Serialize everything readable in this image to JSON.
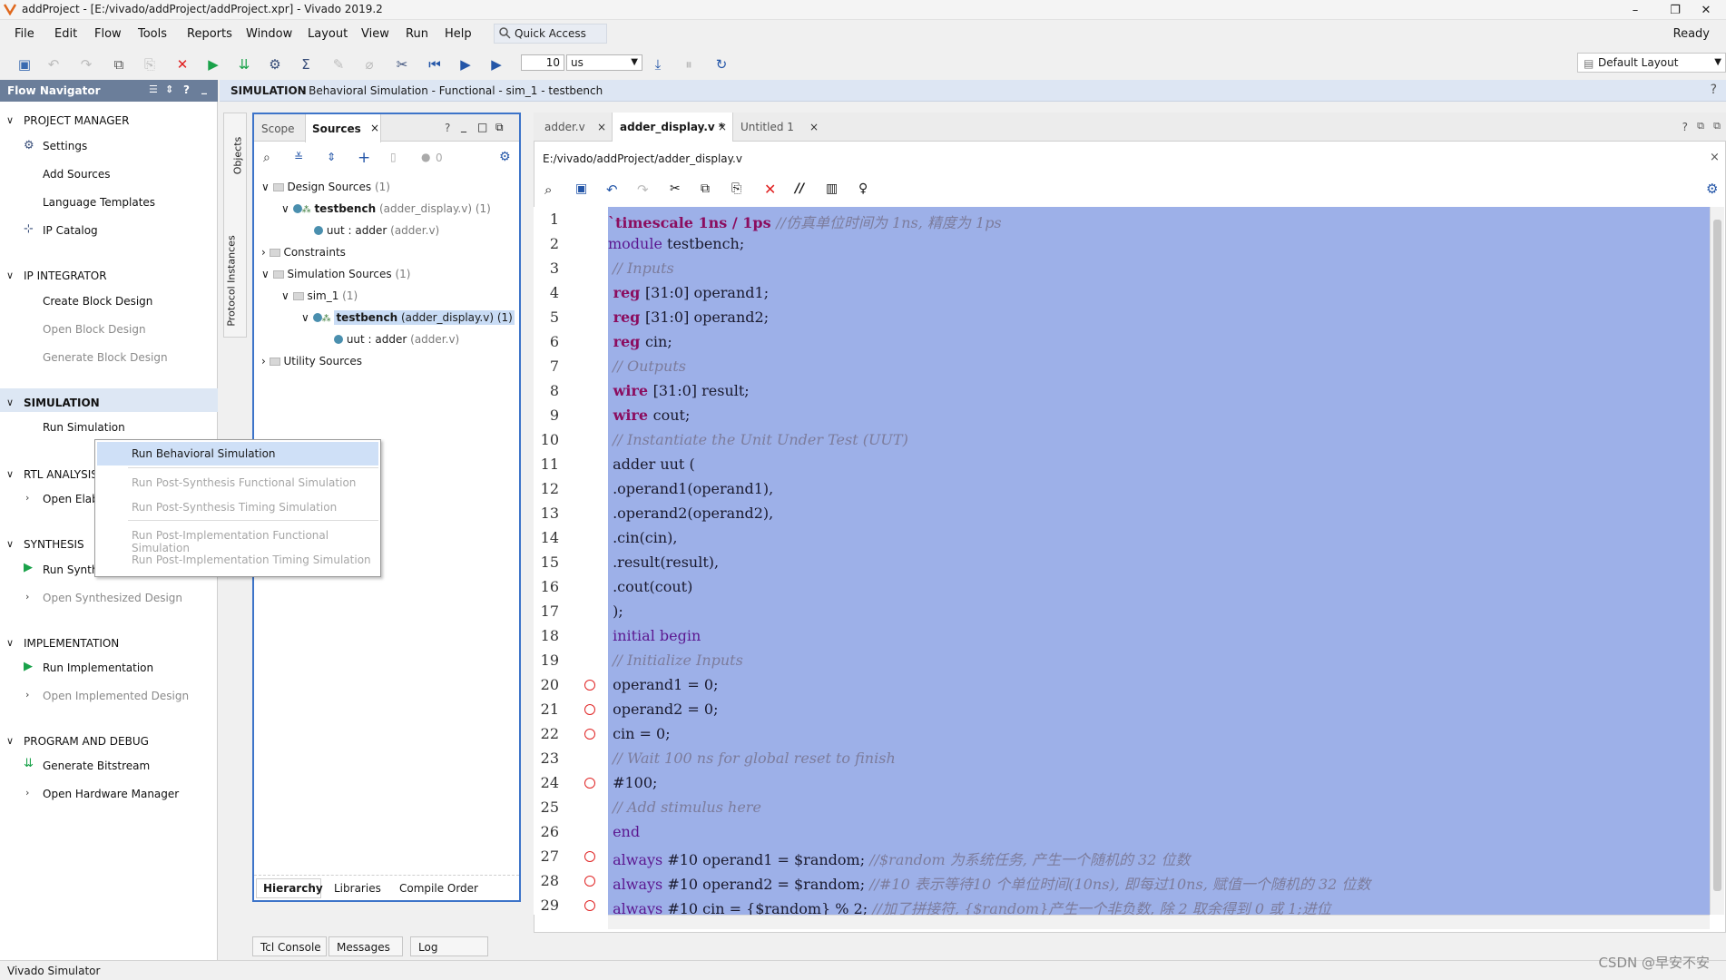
{
  "window": {
    "title": "addProject - [E:/vivado/addProject/addProject.xpr] - Vivado 2019.2",
    "status": "Ready",
    "quick_access": "Quick Access"
  },
  "menu": [
    "File",
    "Edit",
    "Flow",
    "Tools",
    "Reports",
    "Window",
    "Layout",
    "View",
    "Run",
    "Help"
  ],
  "toolbar": {
    "run_time": "10",
    "time_unit": "us",
    "layout": "Default Layout"
  },
  "flow_navigator": {
    "title": "Flow Navigator",
    "sections": {
      "project_manager": {
        "label": "PROJECT MANAGER",
        "items": [
          "Settings",
          "Add Sources",
          "Language Templates",
          "IP Catalog"
        ]
      },
      "ip_integrator": {
        "label": "IP INTEGRATOR",
        "items": [
          "Create Block Design",
          "Open Block Design",
          "Generate Block Design"
        ]
      },
      "simulation": {
        "label": "SIMULATION",
        "items": [
          "Run Simulation"
        ]
      },
      "rtl_analysis": {
        "label": "RTL ANALYSIS",
        "items": [
          "Open Elab"
        ]
      },
      "synthesis": {
        "label": "SYNTHESIS",
        "items": [
          "Run Synth",
          "Open Synthesized Design"
        ]
      },
      "implementation": {
        "label": "IMPLEMENTATION",
        "items": [
          "Run Implementation",
          "Open Implemented Design"
        ]
      },
      "program_debug": {
        "label": "PROGRAM AND DEBUG",
        "items": [
          "Generate Bitstream",
          "Open Hardware Manager"
        ]
      }
    }
  },
  "context_menu": {
    "items": [
      "Run Behavioral Simulation",
      "Run Post-Synthesis Functional Simulation",
      "Run Post-Synthesis Timing Simulation",
      "Run Post-Implementation Functional Simulation",
      "Run Post-Implementation Timing Simulation"
    ]
  },
  "sim_header": {
    "prefix": "SIMULATION",
    "detail": " - Behavioral Simulation - Functional - sim_1 - testbench"
  },
  "side_tabs": [
    "Objects",
    "Protocol Instances"
  ],
  "sources": {
    "tabs": [
      "Scope",
      "Sources"
    ],
    "badge": "0",
    "tree": {
      "design_sources": "Design Sources",
      "design_sources_count": " (1)",
      "testbench": "testbench",
      "testbench_file": " (adder_display.v) (1)",
      "uut": "uut : adder",
      "uut_file": " (adder.v)",
      "constraints": "Constraints",
      "sim_sources": "Simulation Sources",
      "sim_sources_count": " (1)",
      "sim_1": "sim_1",
      "sim_1_count": " (1)",
      "testbench2": "testbench",
      "testbench2_file": " (adder_display.v) (1)",
      "uut2": "uut : adder",
      "uut2_file": " (adder.v)",
      "utility": "Utility Sources"
    },
    "bottom_tabs": [
      "Hierarchy",
      "Libraries",
      "Compile Order"
    ]
  },
  "editor": {
    "tabs": [
      "adder.v",
      "adder_display.v *",
      "Untitled 1"
    ],
    "file_path": "E:/vivado/addProject/adder_display.v",
    "lines": [
      [
        {
          "t": "`timescale 1ns / 1ps ",
          "c": "kw"
        },
        {
          "t": "//仿真单位时间为 1ns, 精度为 1ps",
          "c": "cm"
        }
      ],
      [
        {
          "t": "module ",
          "c": "kw2"
        },
        {
          "t": "testbench;",
          "c": ""
        }
      ],
      [
        {
          "t": " // Inputs",
          "c": "cm"
        }
      ],
      [
        {
          "t": " reg ",
          "c": "kw"
        },
        {
          "t": "[31:0] operand1;",
          "c": ""
        }
      ],
      [
        {
          "t": " reg ",
          "c": "kw"
        },
        {
          "t": "[31:0] operand2;",
          "c": ""
        }
      ],
      [
        {
          "t": " reg ",
          "c": "kw"
        },
        {
          "t": "cin;",
          "c": ""
        }
      ],
      [
        {
          "t": " // Outputs",
          "c": "cm"
        }
      ],
      [
        {
          "t": " wire ",
          "c": "kw"
        },
        {
          "t": "[31:0] result;",
          "c": ""
        }
      ],
      [
        {
          "t": " wire ",
          "c": "kw"
        },
        {
          "t": "cout;",
          "c": ""
        }
      ],
      [
        {
          "t": " // Instantiate the Unit Under Test (UUT)",
          "c": "cm"
        }
      ],
      [
        {
          "t": " adder uut (",
          "c": ""
        }
      ],
      [
        {
          "t": " .operand1(operand1),",
          "c": ""
        }
      ],
      [
        {
          "t": " .operand2(operand2),",
          "c": ""
        }
      ],
      [
        {
          "t": " .cin(cin),",
          "c": ""
        }
      ],
      [
        {
          "t": " .result(result),",
          "c": ""
        }
      ],
      [
        {
          "t": " .cout(cout)",
          "c": ""
        }
      ],
      [
        {
          "t": " );",
          "c": ""
        }
      ],
      [
        {
          "t": " initial begin",
          "c": "kw2"
        }
      ],
      [
        {
          "t": " // Initialize Inputs",
          "c": "cm"
        }
      ],
      [
        {
          "t": " operand1 = 0;",
          "c": ""
        }
      ],
      [
        {
          "t": " operand2 = 0;",
          "c": ""
        }
      ],
      [
        {
          "t": " cin = 0;",
          "c": ""
        }
      ],
      [
        {
          "t": " // Wait 100 ns for global reset to finish",
          "c": "cm"
        }
      ],
      [
        {
          "t": " #100;",
          "c": ""
        }
      ],
      [
        {
          "t": " // Add stimulus here",
          "c": "cm"
        }
      ],
      [
        {
          "t": " end",
          "c": "kw2"
        }
      ],
      [
        {
          "t": " always ",
          "c": "kw2"
        },
        {
          "t": "#10 operand1 = $random; ",
          "c": ""
        },
        {
          "t": "//$random 为系统任务, 产生一个随机的 32 位数",
          "c": "cm"
        }
      ],
      [
        {
          "t": " always ",
          "c": "kw2"
        },
        {
          "t": "#10 operand2 = $random; ",
          "c": ""
        },
        {
          "t": "//#10 表示等待10 个单位时间(10ns), 即每过10ns, 赋值一个随机的 32 位数",
          "c": "cm"
        }
      ],
      [
        {
          "t": " always ",
          "c": "kw2"
        },
        {
          "t": "#10 cin = {$random} % 2; ",
          "c": ""
        },
        {
          "t": "//加了拼接符, {$random}产生一个非负数, 除 2 取余得到 0 或 1;进位",
          "c": "cm"
        }
      ]
    ],
    "breakpoint_lines": [
      20,
      21,
      22,
      24,
      27,
      28,
      29
    ]
  },
  "console_tabs": [
    "Tcl Console",
    "Messages",
    "Log"
  ],
  "status_bar": "Vivado Simulator",
  "watermark": "CSDN @早安不安",
  "colors": {
    "selection": "#9db0e8",
    "nav_header": "#6b7e9a",
    "panel_border": "#3d74c9",
    "keyword": "#8b0d5f"
  }
}
